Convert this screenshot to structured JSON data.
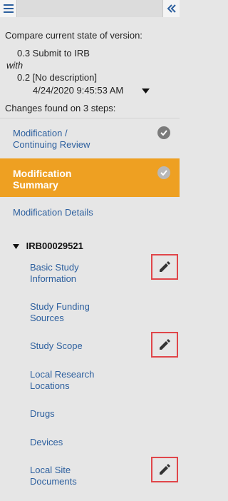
{
  "compare": {
    "heading": "Compare current state of version:",
    "current_version": "0.3 Submit to IRB",
    "with_label": "with",
    "other_version": "0.2 [No description]",
    "other_version_date": "4/24/2020 9:45:53 AM",
    "changes_summary": "Changes found on 3 steps:"
  },
  "nav": {
    "items": [
      {
        "line1": "Modification /",
        "line2": "Continuing Review"
      },
      {
        "line1": "Modification",
        "line2": "Summary"
      },
      {
        "line1": "Modification Details"
      }
    ],
    "group_label": "IRB00029521",
    "sub_items": [
      {
        "line1": "Basic Study",
        "line2": "Information"
      },
      {
        "line1": "Study Funding",
        "line2": "Sources"
      },
      {
        "line1": "Study Scope"
      },
      {
        "line1": "Local Research",
        "line2": "Locations"
      },
      {
        "line1": "Drugs"
      },
      {
        "line1": "Devices"
      },
      {
        "line1": "Local Site",
        "line2": "Documents"
      }
    ]
  },
  "colors": {
    "active_background": "#eea022",
    "link": "#2c5f9e",
    "highlight_border": "#e0464a",
    "panel_background": "#e6e6e6"
  },
  "icons": {
    "menu": "hamburger-icon",
    "collapse": "double-chevron-left-icon",
    "dropdown": "caret-down-icon",
    "completed": "check-circle-icon",
    "edited": "pencil-icon",
    "expand": "triangle-down-icon"
  }
}
